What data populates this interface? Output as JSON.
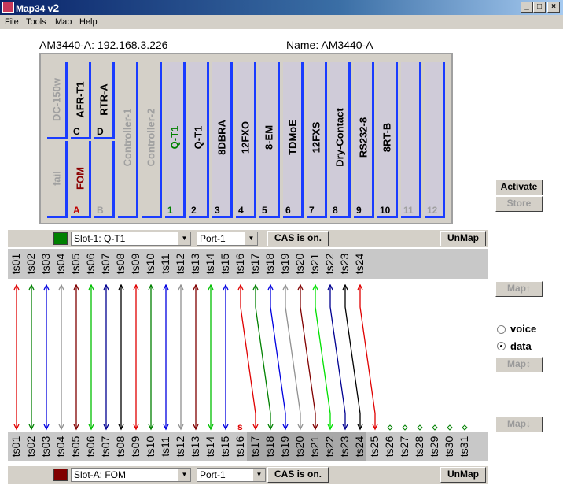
{
  "window": {
    "title": "Map34 v",
    "title_version": "2",
    "buttons": [
      "_",
      "□",
      "×"
    ]
  },
  "menu": [
    "File",
    "Tools",
    "Map",
    "Help"
  ],
  "device": {
    "header_left": "AM3440-A: 192.168.3.226",
    "header_right": "Name: AM3440-A"
  },
  "cards": [
    {
      "label": "DC-150w",
      "slot": "",
      "color": "#a0a0a0"
    },
    {
      "label": "fail",
      "slot": "",
      "color": "#a0a0a0"
    },
    {
      "label": "AFR-T1",
      "slot": "C",
      "color": "#000000"
    },
    {
      "label": "FOM",
      "slot": "A",
      "color": "#8b0000"
    },
    {
      "label": "RTR-A",
      "slot": "D",
      "color": "#000000"
    },
    {
      "label": "",
      "slot": "B",
      "color": "#a0a0a0"
    },
    {
      "label": "Controller-1",
      "slot": "",
      "color": "#a0a0a0"
    },
    {
      "label": "Controller-2",
      "slot": "",
      "color": "#a0a0a0"
    },
    {
      "label": "Q-T1",
      "slot": "1",
      "color": "#008000"
    },
    {
      "label": "Q-T1",
      "slot": "2",
      "color": "#000000"
    },
    {
      "label": "8DBRA",
      "slot": "3",
      "color": "#000000"
    },
    {
      "label": "12FXO",
      "slot": "4",
      "color": "#000000"
    },
    {
      "label": "8-EM",
      "slot": "5",
      "color": "#000000"
    },
    {
      "label": "TDMoE",
      "slot": "6",
      "color": "#000000"
    },
    {
      "label": "12FXS",
      "slot": "7",
      "color": "#000000"
    },
    {
      "label": "Dry-Contact",
      "slot": "8",
      "color": "#000000"
    },
    {
      "label": "RS232-8",
      "slot": "9",
      "color": "#000000"
    },
    {
      "label": "8RT-B",
      "slot": "10",
      "color": "#000000"
    },
    {
      "label": "",
      "slot": "11",
      "color": "#a0a0a0"
    },
    {
      "label": "",
      "slot": "12",
      "color": "#a0a0a0"
    }
  ],
  "side": {
    "activate": "Activate",
    "store": "Store",
    "map_up": "Map↑",
    "map_both": "Map↕",
    "map_down": "Map↓",
    "voice": "voice",
    "data": "data"
  },
  "top_row": {
    "slot": "Slot-1: Q-T1",
    "port": "Port-1",
    "cas": "CAS is on.",
    "unmap": "UnMap",
    "color": "#008000"
  },
  "bottom_row": {
    "slot": "Slot-A: FOM",
    "port": "Port-1",
    "cas": "CAS is on.",
    "unmap": "UnMap",
    "color": "#800000"
  },
  "top_ts": [
    "ts01",
    "ts02",
    "ts03",
    "ts04",
    "ts05",
    "ts06",
    "ts07",
    "ts08",
    "ts09",
    "ts10",
    "ts11",
    "ts12",
    "ts13",
    "ts14",
    "ts15",
    "ts16",
    "ts17",
    "ts18",
    "ts19",
    "ts20",
    "ts21",
    "ts22",
    "ts23",
    "ts24"
  ],
  "bottom_ts": [
    "ts01",
    "ts02",
    "ts03",
    "ts04",
    "ts05",
    "ts06",
    "ts07",
    "ts08",
    "ts09",
    "ts10",
    "ts11",
    "ts12",
    "ts13",
    "ts14",
    "ts15",
    "ts16",
    "ts17",
    "ts18",
    "ts19",
    "ts20",
    "ts21",
    "ts22",
    "ts23",
    "ts24",
    "ts25",
    "ts26",
    "ts27",
    "ts28",
    "ts29",
    "ts30",
    "ts31"
  ],
  "signal_mark": "s",
  "mappings": [
    {
      "from": 1,
      "to": 1,
      "color": "#e00000"
    },
    {
      "from": 2,
      "to": 2,
      "color": "#008000"
    },
    {
      "from": 3,
      "to": 3,
      "color": "#0000e0"
    },
    {
      "from": 4,
      "to": 4,
      "color": "#909090"
    },
    {
      "from": 5,
      "to": 5,
      "color": "#800000"
    },
    {
      "from": 6,
      "to": 6,
      "color": "#00c000"
    },
    {
      "from": 7,
      "to": 7,
      "color": "#000090"
    },
    {
      "from": 8,
      "to": 8,
      "color": "#000000"
    },
    {
      "from": 9,
      "to": 9,
      "color": "#e00000"
    },
    {
      "from": 10,
      "to": 10,
      "color": "#008000"
    },
    {
      "from": 11,
      "to": 11,
      "color": "#0000e0"
    },
    {
      "from": 12,
      "to": 12,
      "color": "#909090"
    },
    {
      "from": 13,
      "to": 13,
      "color": "#800000"
    },
    {
      "from": 14,
      "to": 14,
      "color": "#00c000"
    },
    {
      "from": 15,
      "to": 15,
      "color": "#0000e0"
    },
    {
      "from": 16,
      "to": 17,
      "color": "#e00000"
    },
    {
      "from": 17,
      "to": 18,
      "color": "#008000"
    },
    {
      "from": 18,
      "to": 19,
      "color": "#0000e0"
    },
    {
      "from": 19,
      "to": 20,
      "color": "#909090"
    },
    {
      "from": 20,
      "to": 21,
      "color": "#800000"
    },
    {
      "from": 21,
      "to": 22,
      "color": "#00e000"
    },
    {
      "from": 22,
      "to": 23,
      "color": "#000090"
    },
    {
      "from": 23,
      "to": 24,
      "color": "#000000"
    },
    {
      "from": 24,
      "to": 25,
      "color": "#e00000"
    }
  ],
  "unmapped_bottom": [
    26,
    27,
    28,
    29,
    30,
    31
  ]
}
